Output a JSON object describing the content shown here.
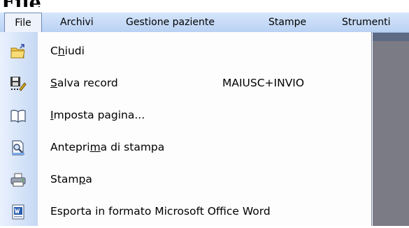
{
  "page_title": "File",
  "menubar": {
    "items": [
      {
        "label": "File"
      },
      {
        "label": "Archivi"
      },
      {
        "label": "Gestione paziente"
      },
      {
        "label": "Stampe"
      },
      {
        "label": "Strumenti"
      }
    ]
  },
  "menu": {
    "items": [
      {
        "pre": "C",
        "mn": "h",
        "post": "iudi",
        "shortcut": "",
        "icon": "folder-exit-icon"
      },
      {
        "pre": "",
        "mn": "S",
        "post": "alva record",
        "shortcut": "MAIUSC+INVIO",
        "icon": "save-record-icon"
      },
      {
        "pre": "",
        "mn": "I",
        "post": "mposta pagina...",
        "shortcut": "",
        "icon": "page-setup-icon"
      },
      {
        "pre": "Antepri",
        "mn": "m",
        "post": "a di stampa",
        "shortcut": "",
        "icon": "print-preview-icon"
      },
      {
        "pre": "Stam",
        "mn": "p",
        "post": "a",
        "shortcut": "",
        "icon": "printer-icon"
      },
      {
        "pre": "Esporta in formato Microsoft Office Word",
        "mn": "",
        "post": "",
        "shortcut": "",
        "icon": "word-export-icon"
      }
    ]
  }
}
